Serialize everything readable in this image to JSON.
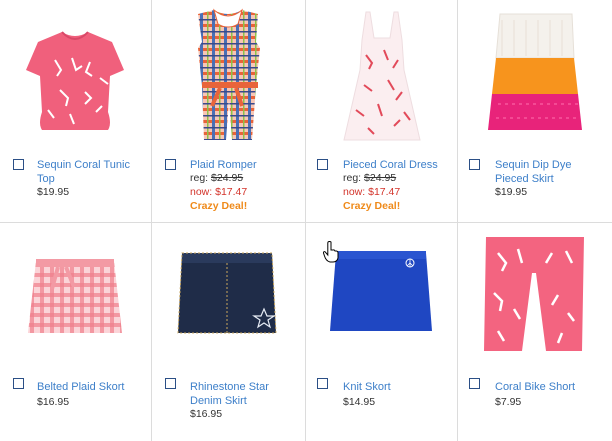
{
  "products": [
    {
      "name": "Sequin Coral Tunic Top",
      "line1": "Sequin Coral Tunic",
      "line2": "Top",
      "price": "$19.95",
      "image": "pink-coral-tunic-top-image"
    },
    {
      "name": "Plaid Romper",
      "line1": "Plaid Romper",
      "line2": "",
      "reg_label": "reg:",
      "reg_price": "$24.95",
      "now_label": "now:",
      "now_price": "$17.47",
      "deal": "Crazy Deal!",
      "image": "plaid-romper-image"
    },
    {
      "name": "Pieced Coral Dress",
      "line1": "Pieced Coral Dress",
      "line2": "",
      "reg_label": "reg:",
      "reg_price": "$24.95",
      "now_label": "now:",
      "now_price": "$17.47",
      "deal": "Crazy Deal!",
      "image": "coral-dress-image"
    },
    {
      "name": "Sequin Dip Dye Pieced Skirt",
      "line1": "Sequin Dip Dye",
      "line2": "Pieced Skirt",
      "price": "$19.95",
      "image": "dip-dye-skirt-image"
    },
    {
      "name": "Belted Plaid Skort",
      "line1": "Belted Plaid Skort",
      "line2": "",
      "price": "$16.95",
      "image": "plaid-skort-image"
    },
    {
      "name": "Rhinestone Star Denim Skirt",
      "line1": "Rhinestone Star",
      "line2": "Denim Skirt",
      "price": "$16.95",
      "image": "denim-skirt-image"
    },
    {
      "name": "Knit Skort",
      "line1": "Knit Skort",
      "line2": "",
      "price": "$14.95",
      "image": "knit-skort-image"
    },
    {
      "name": "Coral Bike Short",
      "line1": "Coral Bike Short",
      "line2": "",
      "price": "$7.95",
      "image": "coral-bike-short-image"
    }
  ],
  "colors": {
    "link": "#3d7fc9",
    "sale": "#d3332a",
    "deal": "#ef8a1a",
    "border": "#dcdcdc",
    "checkbox": "#2b4f86"
  }
}
